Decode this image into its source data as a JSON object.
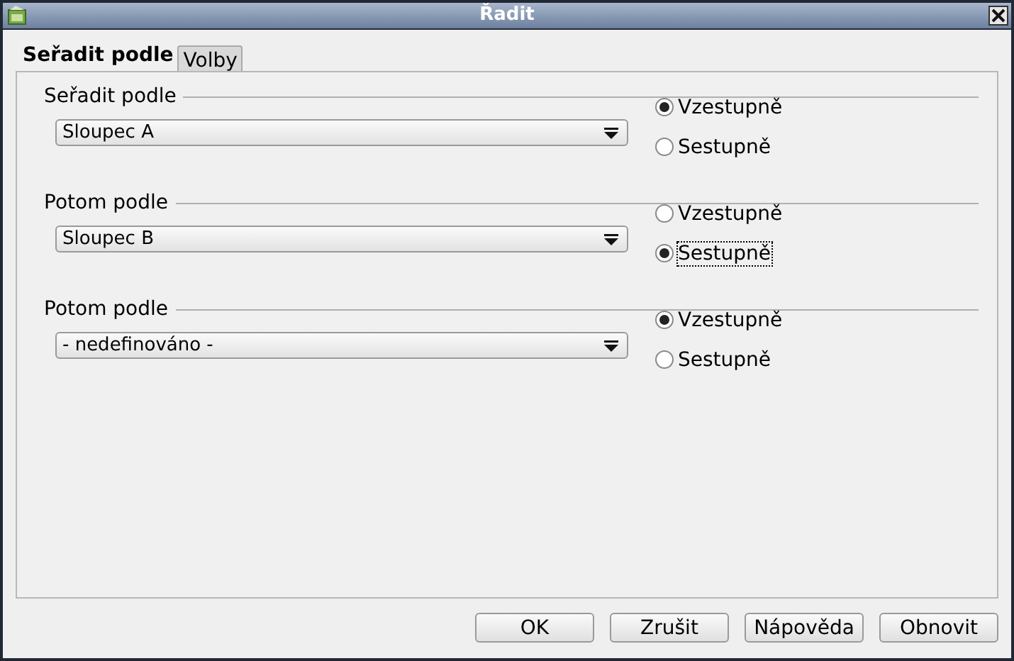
{
  "window": {
    "title": "Řadit"
  },
  "tabs": [
    {
      "label": "Seřadit podle",
      "selected": true
    },
    {
      "label": "Volby",
      "selected": false
    }
  ],
  "groups": [
    {
      "label": "Seřadit podle",
      "combo": {
        "value": "Sloupec A"
      },
      "options": [
        {
          "label": "Vzestupně",
          "selected": true,
          "focused": false
        },
        {
          "label": "Sestupně",
          "selected": false,
          "focused": false
        }
      ]
    },
    {
      "label": "Potom podle",
      "combo": {
        "value": "Sloupec B"
      },
      "options": [
        {
          "label": "Vzestupně",
          "selected": false,
          "focused": false
        },
        {
          "label": "Sestupně",
          "selected": true,
          "focused": true
        }
      ]
    },
    {
      "label": "Potom podle",
      "combo": {
        "value": "- nedefinováno -"
      },
      "options": [
        {
          "label": "Vzestupně",
          "selected": true,
          "focused": false
        },
        {
          "label": "Sestupně",
          "selected": false,
          "focused": false
        }
      ]
    }
  ],
  "buttons": [
    "OK",
    "Zrušit",
    "Nápověda",
    "Obnovit"
  ]
}
